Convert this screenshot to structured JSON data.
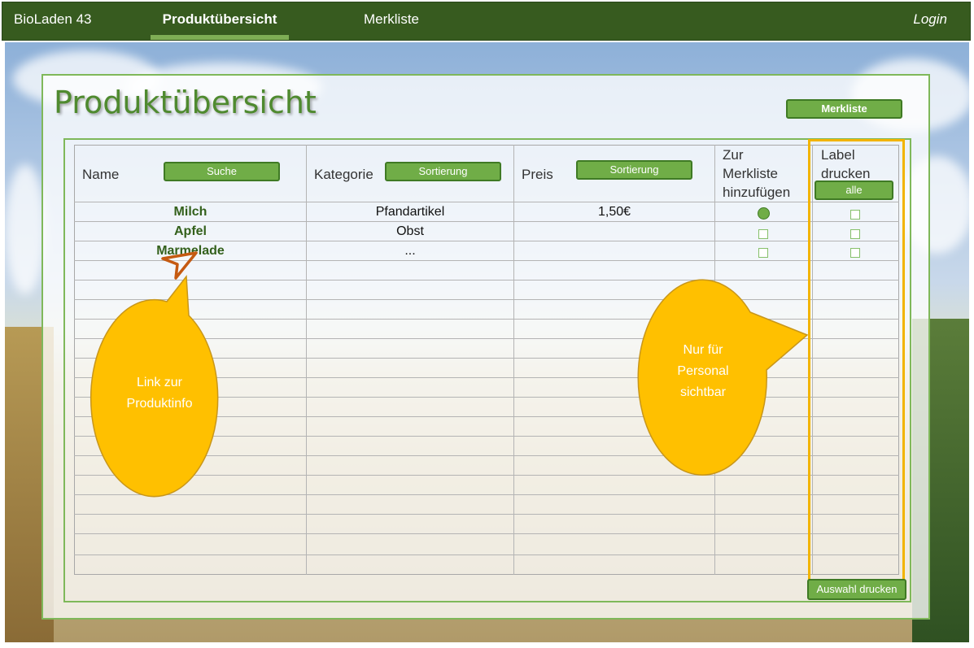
{
  "nav": {
    "brand": "BioLaden 43",
    "products": "Produktübersicht",
    "wishlist": "Merkliste",
    "login": "Login"
  },
  "page": {
    "title": "Produktübersicht",
    "wishlist_button": "Merkliste"
  },
  "table": {
    "headers": {
      "name": "Name",
      "search_button": "Suche",
      "category": "Kategorie",
      "category_sort_button": "Sortierung",
      "price": "Preis",
      "price_sort_button": "Sortierung",
      "add_to_wishlist": [
        "Zur",
        "Merkliste",
        "hinzufügen"
      ],
      "print_label": [
        "Label",
        "drucken"
      ],
      "all_button": "alle"
    },
    "rows": [
      {
        "name": "Milch",
        "category": "Pfandartikel",
        "price": "1,50€",
        "wishlist": "selected",
        "label": "unchecked"
      },
      {
        "name": "Apfel",
        "category": "Obst",
        "price": "",
        "wishlist": "unchecked",
        "label": "unchecked"
      },
      {
        "name": "Marmelade",
        "category": "...",
        "price": "",
        "wishlist": "unchecked",
        "label": "unchecked"
      }
    ],
    "print_selection_button": "Auswahl drucken"
  },
  "annotations": {
    "link_note": [
      "Link zur",
      "Produktinfo"
    ],
    "staff_note": [
      "Nur für",
      "Personal",
      "sichtbar"
    ]
  },
  "colors": {
    "nav_bg": "#375b1f",
    "accent_green": "#70ad47",
    "title_green": "#4f8a2f",
    "callout_yellow": "#ffc000",
    "highlight_border": "#f2b400",
    "arrow_orange": "#c55a11"
  }
}
